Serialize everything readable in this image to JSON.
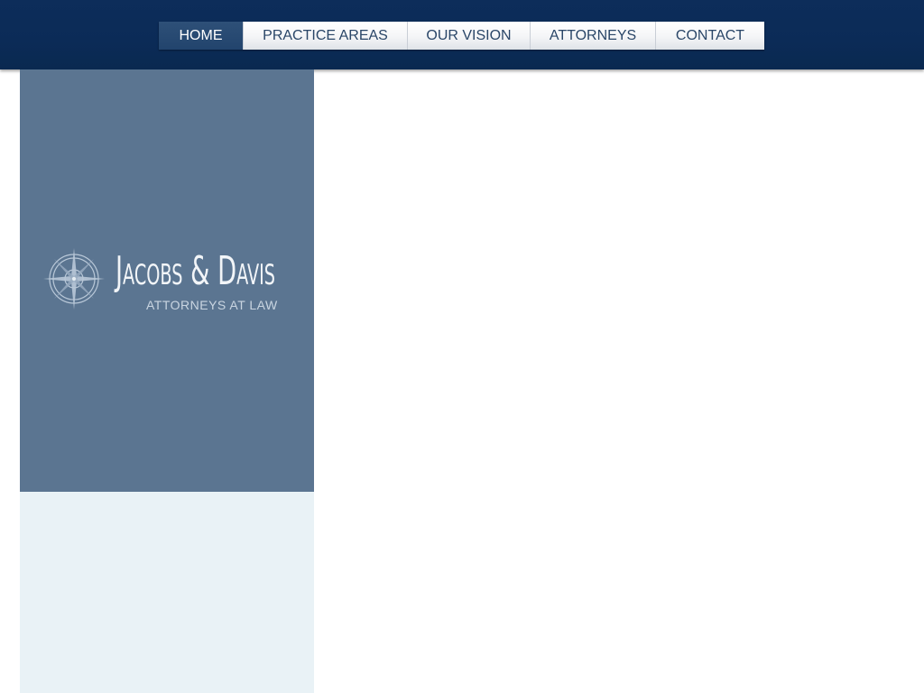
{
  "nav": {
    "items": [
      {
        "label": "HOME",
        "active": true
      },
      {
        "label": "PRACTICE AREAS",
        "active": false
      },
      {
        "label": "OUR VISION",
        "active": false
      },
      {
        "label": "ATTORNEYS",
        "active": false
      },
      {
        "label": "CONTACT",
        "active": false
      }
    ]
  },
  "logo": {
    "name": "Jacobs & Davis",
    "tagline": "ATTORNEYS AT LAW",
    "emblem_icon": "compass-rose-icon"
  },
  "colors": {
    "header": "#0b2b57",
    "side_panel": "#5b7591",
    "side_lower": "#e9f2f6",
    "nav_active": "#22446d",
    "nav_text": "#2a4668"
  }
}
